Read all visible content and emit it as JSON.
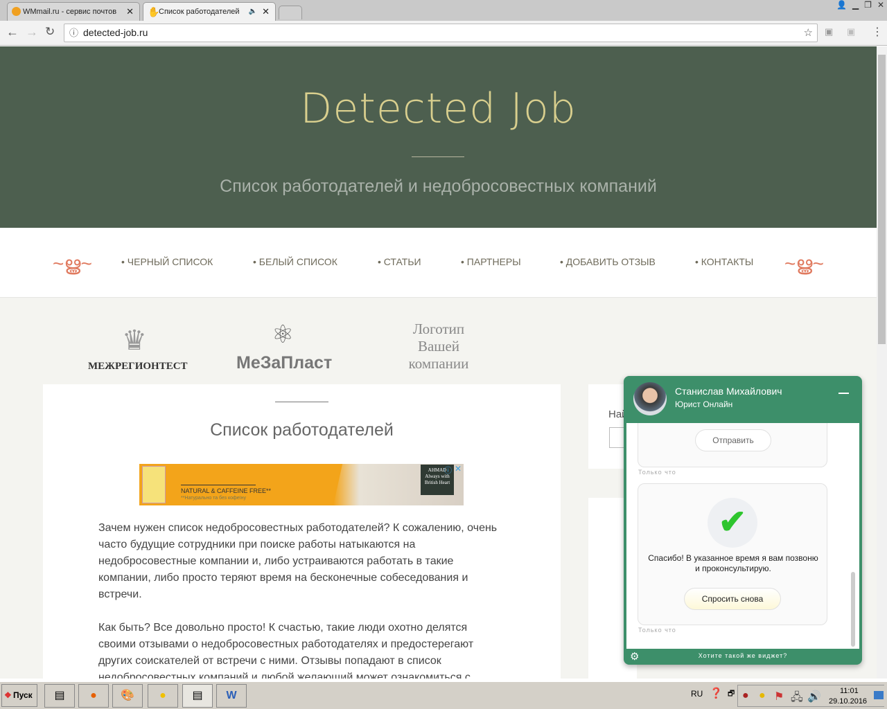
{
  "browser": {
    "tabs": [
      {
        "label": "WMmail.ru - сервис почтов"
      },
      {
        "label": "Список работодателей"
      }
    ],
    "url": "detected-job.ru"
  },
  "hero": {
    "title": "Detected Job",
    "subtitle": "Список работодателей и недобросовестных компаний"
  },
  "nav": {
    "items": [
      "• ЧЕРНЫЙ СПИСОК",
      "• БЕЛЫЙ СПИСОК",
      "• СТАТЬИ",
      "• ПАРТНЕРЫ",
      "• ДОБАВИТЬ ОТЗЫВ",
      "• КОНТАКТЫ"
    ]
  },
  "partners": {
    "logo1": "МЕЖРЕГИОНТЕСТ",
    "logo2": "МеЗаПласт",
    "logo3": "Логотип Вашей компании"
  },
  "main": {
    "heading": "Список работодателей",
    "ad": {
      "headline": "NATURAL & CAFFEINE FREE**",
      "sub": "**Натурально та без кофеїну",
      "brand": "AHMAD",
      "tagline": "Always with British Heart"
    },
    "paragraphs": [
      "Зачем нужен список недобросовестных работодателей? К сожалению, очень часто будущие сотрудники при поиске работы натыкаются на недобросовестные компании и, либо устраиваются работать в такие компании, либо просто теряют время на бесконечные собеседования и встречи.",
      "Как быть? Все довольно просто! К счастью, такие люди охотно делятся своими отзывами о недобросовестных работодателях и предостерегают других соискателей от встречи с ними. Отзывы попадают в список недобросовестных компаний и любой желающий может ознакомиться с"
    ]
  },
  "sidebar": {
    "search_label": "Най"
  },
  "chat": {
    "name": "Станислав Михайлович",
    "role": "Юрист Онлайн",
    "send": "Отправить",
    "time1": "Только что",
    "thanks": "Спасибо! В указанное время я вам позвоню и проконсультирую.",
    "ask_again": "Спросить снова",
    "time2": "Только что",
    "footer": "Хотите такой же виджет?"
  },
  "taskbar": {
    "start": "Пуск",
    "lang": "RU",
    "time": "11:01",
    "date": "29.10.2016"
  }
}
